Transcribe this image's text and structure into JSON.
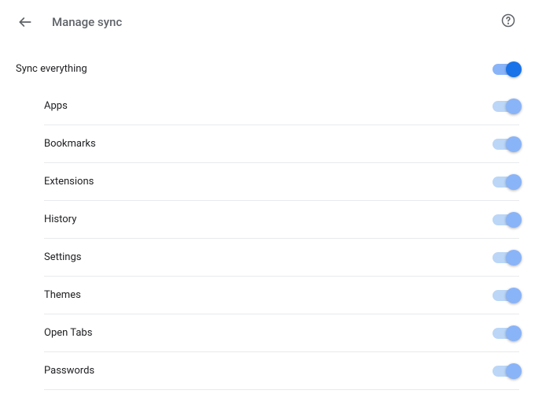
{
  "header": {
    "title": "Manage sync"
  },
  "master": {
    "label": "Sync everything",
    "on": true
  },
  "items": [
    {
      "label": "Apps",
      "on": true
    },
    {
      "label": "Bookmarks",
      "on": true
    },
    {
      "label": "Extensions",
      "on": true
    },
    {
      "label": "History",
      "on": true
    },
    {
      "label": "Settings",
      "on": true
    },
    {
      "label": "Themes",
      "on": true
    },
    {
      "label": "Open Tabs",
      "on": true
    },
    {
      "label": "Passwords",
      "on": true
    }
  ]
}
